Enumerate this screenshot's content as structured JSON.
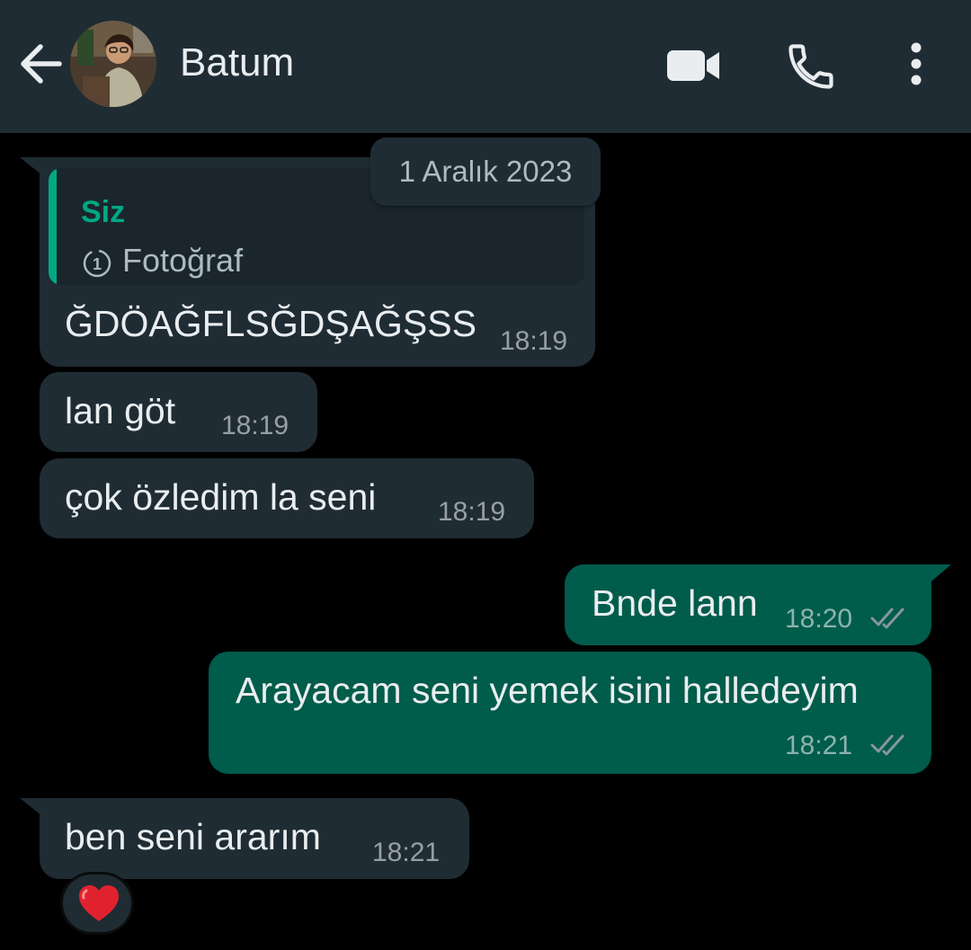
{
  "header": {
    "contact_name": "Batum"
  },
  "date_chip": "1 Aralık 2023",
  "messages": [
    {
      "direction": "incoming",
      "quote": {
        "author": "Siz",
        "label": "Fotoğraf"
      },
      "text": "ĞDÖAĞFLSĞDŞAĞŞSS",
      "time": "18:19"
    },
    {
      "direction": "incoming",
      "text": "lan göt",
      "time": "18:19"
    },
    {
      "direction": "incoming",
      "text": "çok özledim la seni",
      "time": "18:19"
    },
    {
      "direction": "outgoing",
      "text": "Bnde lann",
      "time": "18:20",
      "status": "read"
    },
    {
      "direction": "outgoing",
      "text": "Arayacam seni yemek isini halledeyim",
      "time": "18:21",
      "status": "read"
    },
    {
      "direction": "incoming",
      "text": "ben seni ararım",
      "time": "18:21",
      "reaction": "❤️"
    }
  ],
  "icons": {
    "back": "arrow-left-icon",
    "video": "video-camera-icon",
    "call": "phone-icon",
    "menu": "more-vertical-icon",
    "view_once": "view-once-icon",
    "read_ticks": "double-check-icon",
    "reaction": "red-heart-icon"
  },
  "colors": {
    "header_bg": "#1f2c34",
    "chat_bg": "#000000",
    "incoming_bubble": "#1f2c34",
    "outgoing_bubble": "#005c4b",
    "accent": "#00a884",
    "read_ticks": "#8696a0"
  }
}
